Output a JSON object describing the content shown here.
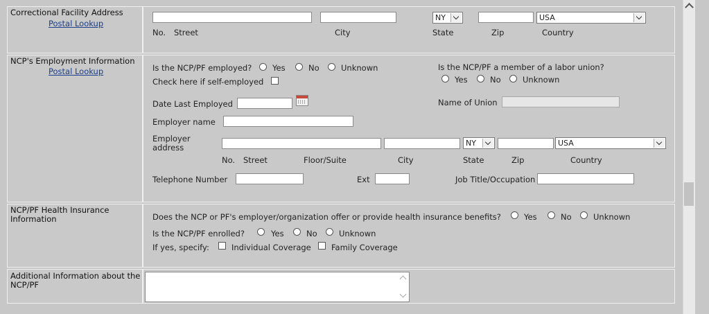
{
  "facility": {
    "label": "Correctional Facility Address",
    "postal_lookup": "Postal Lookup",
    "state": "NY",
    "country": "USA",
    "sub_labels": {
      "no": "No.",
      "street": "Street",
      "city": "City",
      "state": "State",
      "zip": "Zip",
      "country": "Country"
    }
  },
  "employment": {
    "label": "NCP's Employment Information",
    "postal_lookup": "Postal Lookup",
    "employed_q": "Is the NCP/PF employed?",
    "yes": "Yes",
    "no": "No",
    "unknown": "Unknown",
    "self_employed": "Check here if self-employed",
    "union_q": "Is the NCP/PF a member of a labor union?",
    "date_last_employed": "Date Last Employed",
    "name_of_union": "Name of Union",
    "employer_name": "Employer name",
    "employer_address": "Employer address",
    "state": "NY",
    "country": "USA",
    "addr_labels": {
      "no": "No.",
      "street": "Street",
      "floor": "Floor/Suite",
      "city": "City",
      "state": "State",
      "zip": "Zip",
      "country": "Country"
    },
    "telephone": "Telephone Number",
    "ext": "Ext",
    "job_title": "Job Title/Occupation"
  },
  "health": {
    "label": "NCP/PF Health Insurance Information",
    "offer_q": "Does the NCP or PF's employer/organization offer or provide health insurance benefits?",
    "enrolled_q": "Is the NCP/PF enrolled?",
    "yes": "Yes",
    "no": "No",
    "unknown": "Unknown",
    "specify": "If yes, specify:",
    "individual": "Individual Coverage",
    "family": "Family Coverage"
  },
  "additional": {
    "label": "Additional Information about the NCP/PF"
  }
}
